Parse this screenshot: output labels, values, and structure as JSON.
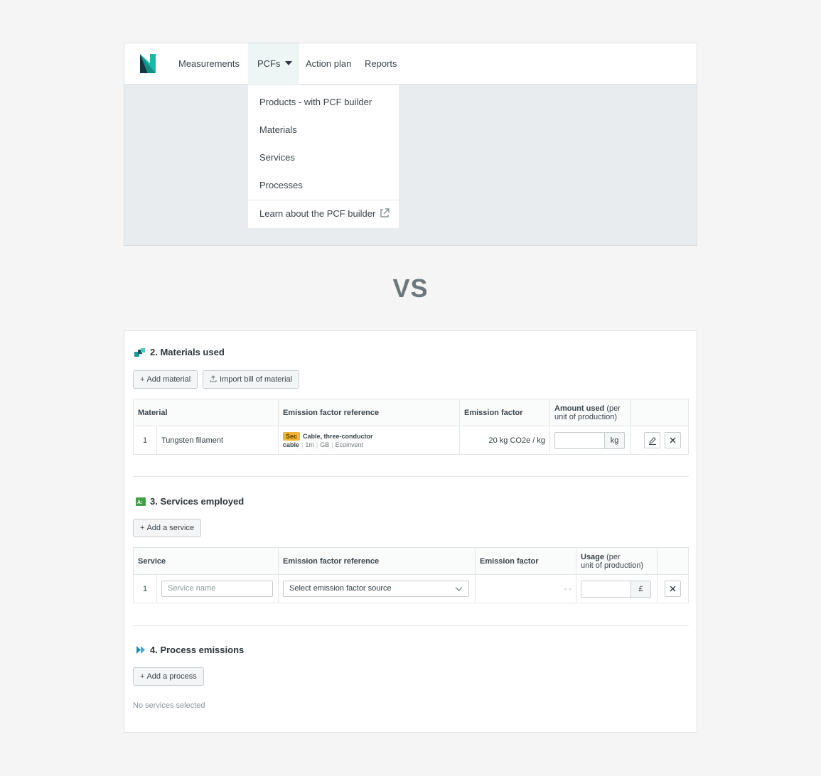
{
  "nav": {
    "items": [
      "Measurements",
      "PCFs",
      "Action plan",
      "Reports"
    ]
  },
  "dropdown": {
    "items": [
      "Products - with PCF builder",
      "Materials",
      "Services",
      "Processes"
    ],
    "learn": "Learn about the PCF builder"
  },
  "vs_label": "VS",
  "materials": {
    "title": "2. Materials used",
    "add_label": "Add material",
    "import_label": "Import bill of material",
    "columns": [
      "Material",
      "Emission factor reference",
      "Emission factor",
      "Amount used",
      "(per unit of production)"
    ],
    "rows": [
      {
        "index": "1",
        "name": "Tungsten filament",
        "badge": "Sec",
        "ref": "Cable, three-conductor cable",
        "meta1": "1m",
        "meta2": "GB",
        "meta3": "Ecoinvent",
        "factor": "20 kg CO2e / kg",
        "unit": "kg"
      }
    ]
  },
  "services": {
    "title": "3. Services employed",
    "add_label": "Add a service",
    "columns": [
      "Service",
      "Emission factor reference",
      "Emission factor",
      "Usage",
      "(per",
      "unit of production)"
    ],
    "row": {
      "index": "1",
      "name_placeholder": "Service name",
      "select_label": "Select emission factor source",
      "factor": "- -",
      "unit": "£"
    }
  },
  "processes": {
    "title": "4. Process emissions",
    "add_label": "Add a process",
    "empty_text": "No services selected"
  },
  "colors": {
    "accent": "#0f9e9a",
    "logo_dark": "#13353d",
    "badge": "#f2b233",
    "services_icon": "#43a047"
  }
}
